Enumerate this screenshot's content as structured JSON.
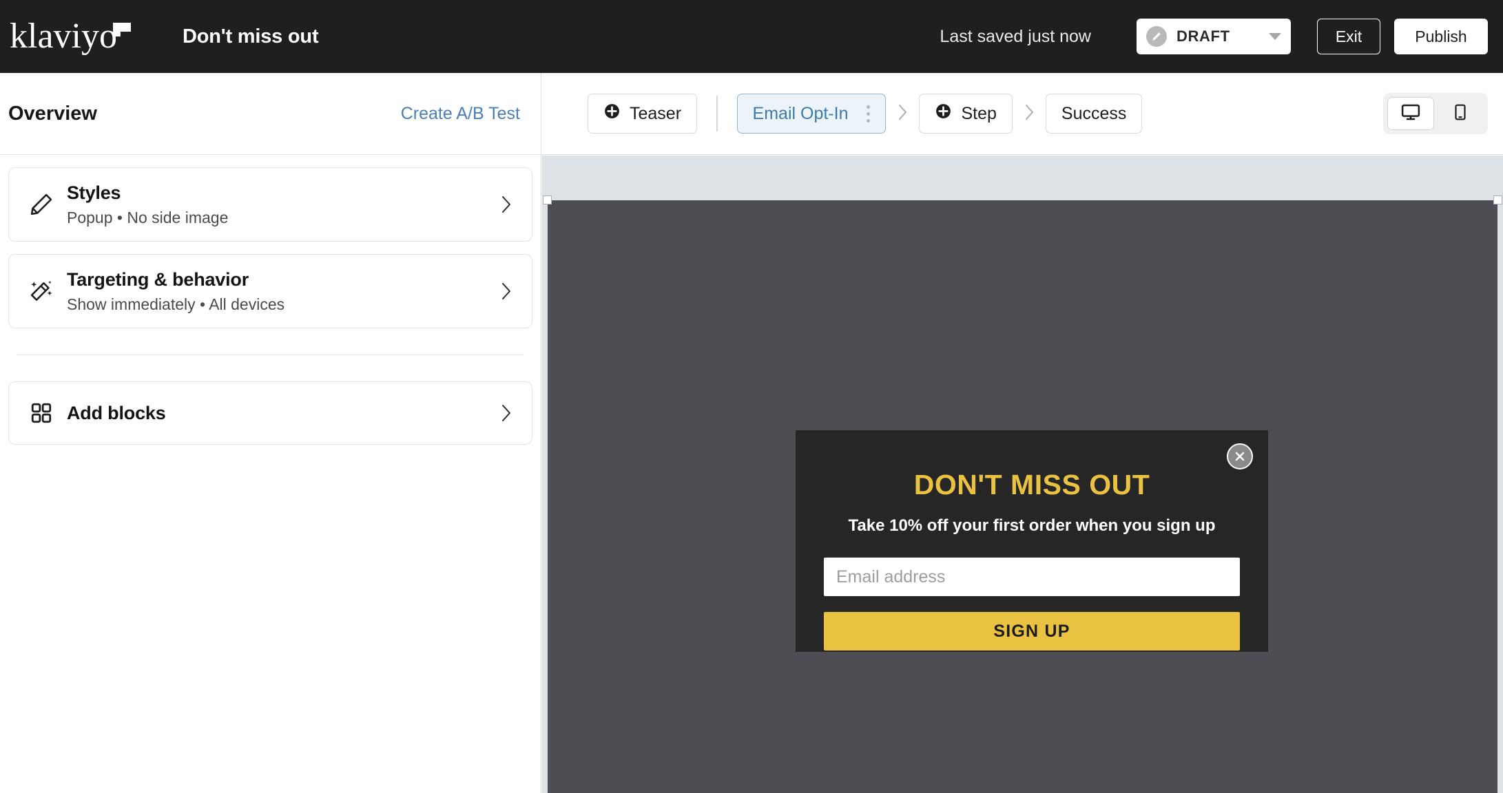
{
  "topbar": {
    "brand": "klaviyo",
    "brand_icon": "flag-icon",
    "doc_title": "Don't miss out",
    "saved_status": "Last saved just now",
    "status": {
      "icon": "draft-pencil-icon",
      "label": "DRAFT",
      "caret_icon": "chevron-down-icon"
    },
    "exit_label": "Exit",
    "publish_label": "Publish"
  },
  "sidebar": {
    "title": "Overview",
    "ab_test_label": "Create A/B Test",
    "cards": [
      {
        "icon": "pencil-icon",
        "title": "Styles",
        "subtitle": "Popup • No side image",
        "chevron": "chevron-right-icon"
      },
      {
        "icon": "magic-wand-icon",
        "title": "Targeting & behavior",
        "subtitle": "Show immediately • All devices",
        "chevron": "chevron-right-icon"
      },
      {
        "icon": "grid-blocks-icon",
        "title": "Add blocks",
        "subtitle": "",
        "chevron": "chevron-right-icon"
      }
    ]
  },
  "steps": {
    "teaser_label": "Teaser",
    "teaser_icon": "plus-circle-icon",
    "active_step_label": "Email Opt-In",
    "active_step_menu_icon": "kebab-menu-icon",
    "add_step_label": "Step",
    "add_step_icon": "plus-circle-icon",
    "success_label": "Success",
    "separator_icon": "chevron-right-icon"
  },
  "device_toggle": {
    "desktop_icon": "desktop-monitor-icon",
    "mobile_icon": "mobile-phone-icon",
    "selected": "desktop"
  },
  "popup_preview": {
    "close_icon": "close-circle-icon",
    "heading": "DON'T MISS OUT",
    "subheading": "Take 10% off your first order when you sign up",
    "email_placeholder": "Email address",
    "submit_label": "SIGN UP",
    "colors": {
      "background": "#262626",
      "heading": "#EAC241",
      "button": "#EAC241",
      "button_text": "#1C1C1C",
      "canvas": "#4D4D53"
    }
  }
}
